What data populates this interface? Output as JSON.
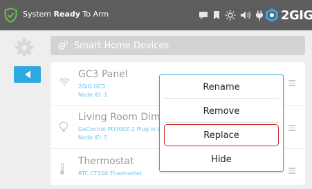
{
  "status_bar": {
    "prefix": "System ",
    "state": "Ready",
    "suffix": " To Arm",
    "icons": [
      "message-icon",
      "bookmark-icon",
      "brightness-icon",
      "volume-icon",
      "power-plug-icon"
    ]
  },
  "brand": {
    "name": "2GIG"
  },
  "nav": {
    "back_icon": "back-arrow-icon"
  },
  "section": {
    "title": "Smart Home Devices"
  },
  "devices": [
    {
      "name": "GC3 Panel",
      "model": "2GIG GC3",
      "node": "Node ID: 1",
      "icon": "wifi-icon"
    },
    {
      "name": "Living Room Dimmer",
      "model": "GoControl PD300Z-2 Plug-in Dimmer",
      "node": "Node ID: 5",
      "icon": "bulb-icon"
    },
    {
      "name": "Thermostat",
      "model": "RTC CT100 Thermostat",
      "node": "",
      "icon": "thermometer-icon"
    }
  ],
  "menu": {
    "items": [
      "Rename",
      "Remove",
      "Replace",
      "Hide"
    ],
    "selected": "Replace"
  },
  "colors": {
    "topbar": "#5d5d5d",
    "accent": "#2ea8e0",
    "shield": "#6cc04a",
    "selected_border": "#c62828"
  }
}
